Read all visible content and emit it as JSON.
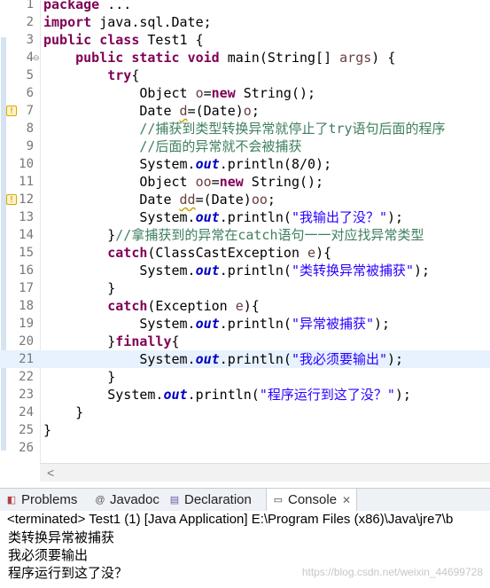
{
  "editor": {
    "lines": [
      {
        "num": "1",
        "html": "<span class=\"kw\">package</span> ..."
      },
      {
        "num": "2",
        "html": "<span class=\"kw\">import</span> java.sql.Date;"
      },
      {
        "num": "3",
        "html": "<span class=\"kw\">public</span> <span class=\"kw\">class</span> Test1 {"
      },
      {
        "num": "4",
        "html": "    <span class=\"kw\">public</span> <span class=\"kw\">static</span> <span class=\"kw\">void</span> main(String[] <span class=\"vr\">args</span>) {",
        "fold": true
      },
      {
        "num": "5",
        "html": "        <span class=\"kw\">try</span>{"
      },
      {
        "num": "6",
        "html": "            Object <span class=\"vr\">o</span>=<span class=\"kw\">new</span> String();"
      },
      {
        "num": "7",
        "html": "            Date <span class=\"vr warn\">d</span>=(Date)<span class=\"vr\">o</span>;",
        "marker": true
      },
      {
        "num": "8",
        "html": "            <span class=\"cm\">//捕获到类型转换异常就停止了try语句后面的程序</span>"
      },
      {
        "num": "9",
        "html": "            <span class=\"cm\">//后面的异常就不会被捕获</span>"
      },
      {
        "num": "10",
        "html": "            System.<span class=\"fd\">out</span>.println(8/0);"
      },
      {
        "num": "11",
        "html": "            Object <span class=\"vr\">oo</span>=<span class=\"kw\">new</span> String();"
      },
      {
        "num": "12",
        "html": "            Date <span class=\"vr warn\">dd</span>=(Date)<span class=\"vr\">oo</span>;",
        "marker": true
      },
      {
        "num": "13",
        "html": "            System.<span class=\"fd\">out</span>.println(<span class=\"st\">\"我输出了没？\"</span>);"
      },
      {
        "num": "14",
        "html": "        }<span class=\"cm\">//拿捕获到的异常在catch语句一一对应找异常类型</span>"
      },
      {
        "num": "15",
        "html": "        <span class=\"kw\">catch</span>(ClassCastException <span class=\"vr\">e</span>){"
      },
      {
        "num": "16",
        "html": "            System.<span class=\"fd\">out</span>.println(<span class=\"st\">\"类转换异常被捕获\"</span>);"
      },
      {
        "num": "17",
        "html": "        }"
      },
      {
        "num": "18",
        "html": "        <span class=\"kw\">catch</span>(Exception <span class=\"vr\">e</span>){"
      },
      {
        "num": "19",
        "html": "            System.<span class=\"fd\">out</span>.println(<span class=\"st\">\"异常被捕获\"</span>);"
      },
      {
        "num": "20",
        "html": "        }<span class=\"kw\">finally</span>{"
      },
      {
        "num": "21",
        "html": "            System.<span class=\"fd\">out</span>.println(<span class=\"st\">\"我必须要输出\"</span>);",
        "highlight": true
      },
      {
        "num": "22",
        "html": "        }"
      },
      {
        "num": "23",
        "html": "        System.<span class=\"fd\">out</span>.println(<span class=\"st\">\"程序运行到这了没？\"</span>);"
      },
      {
        "num": "24",
        "html": "    }"
      },
      {
        "num": "25",
        "html": "}"
      },
      {
        "num": "26",
        "html": ""
      }
    ],
    "scroll_left_arrow": "<"
  },
  "tabs": [
    {
      "label": "Problems",
      "icon": "problems-icon",
      "glyph": "◧"
    },
    {
      "label": "Javadoc",
      "icon": "javadoc-icon",
      "glyph": "@"
    },
    {
      "label": "Declaration",
      "icon": "declaration-icon",
      "glyph": "▤"
    },
    {
      "label": "Console",
      "icon": "console-icon",
      "glyph": "▭",
      "active": true
    }
  ],
  "console": {
    "status": "<terminated> Test1 (1) [Java Application] E:\\Program Files (x86)\\Java\\jre7\\b",
    "output": [
      "类转换异常被捕获",
      "我必须要输出",
      "程序运行到这了没？"
    ],
    "watermark": "https://blog.csdn.net/weixin_44699728"
  }
}
